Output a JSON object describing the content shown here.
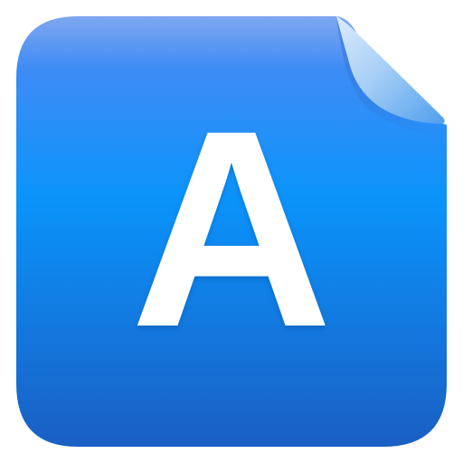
{
  "icon": {
    "name": "font-file-icon",
    "glyph": "A",
    "colors": {
      "top": "#7fa6f0",
      "upper": "#3f8cf5",
      "middle": "#0a94fb",
      "bottom": "#1a63c9",
      "glyph": "#ffffff",
      "curl_light": "#cfe3fb",
      "curl_mid": "#8fc1f4",
      "curl_dark": "#4ea0ee"
    }
  }
}
